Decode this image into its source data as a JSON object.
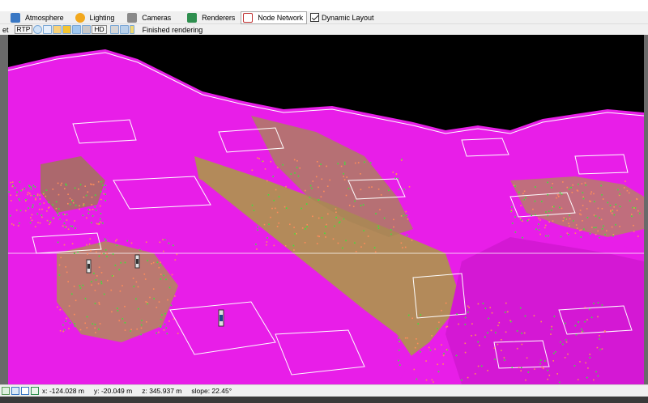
{
  "tabs": [
    {
      "id": "atmosphere",
      "label": "Atmosphere",
      "icon": "atmosphere-icon",
      "color": "#3a78c4"
    },
    {
      "id": "lighting",
      "label": "Lighting",
      "icon": "sun-icon",
      "color": "#f2a81d"
    },
    {
      "id": "cameras",
      "label": "Cameras",
      "icon": "camera-icon",
      "color": "#6a6a6a"
    },
    {
      "id": "renderers",
      "label": "Renderers",
      "icon": "renderer-icon",
      "color": "#2f8f4f"
    },
    {
      "id": "node_network",
      "label": "Node Network",
      "icon": "node-network-icon",
      "color": "#c03030"
    }
  ],
  "dynamic_layout": {
    "label": "Dynamic Layout",
    "checked": true
  },
  "toolbar2": {
    "left_text": "et",
    "rtp_label": "RTP",
    "hd_label": "HD",
    "status": "Finished rendering"
  },
  "status_bar": {
    "x": "x: -124.028 m",
    "y": "y: -20.049 m",
    "z": "z: 345.937 m",
    "slope": "slope: 22.45°"
  },
  "colors": {
    "terrain_magenta": "#e81ee8",
    "terrain_tan": "#b38a5a",
    "sky": "#000000",
    "wire_white": "#ffffff",
    "veg_green": "#39e639",
    "veg_orange": "#ff8c5a"
  }
}
